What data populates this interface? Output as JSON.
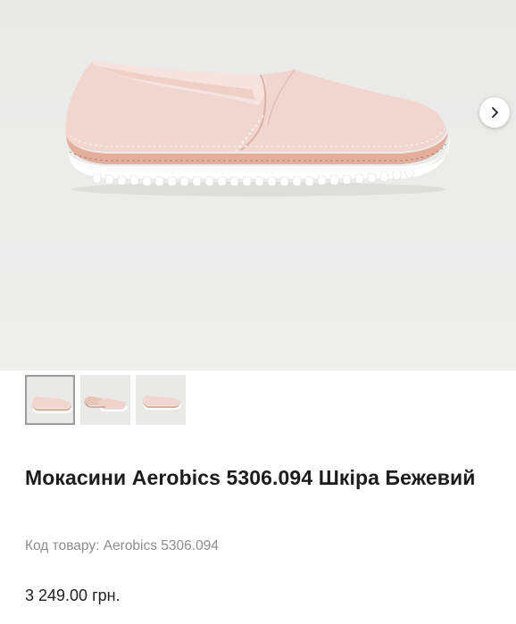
{
  "gallery": {
    "main_image_alt": "",
    "next_icon": "chevron-right-icon",
    "thumbnails": [
      {
        "name": "thumbnail-1",
        "active": true
      },
      {
        "name": "thumbnail-2",
        "active": false
      },
      {
        "name": "thumbnail-3",
        "active": false
      }
    ]
  },
  "product": {
    "title": "Мокасини Aerobics 5306.094 Шкіра Бежевий",
    "sku": "Код товару: Aerobics 5306.094",
    "price": "3 249.00 грн."
  },
  "colors": {
    "shoe_leather": "#f0d6cf",
    "shoe_band": "#e3ae9c",
    "sole": "#ffffff",
    "background": "#ececeb"
  }
}
